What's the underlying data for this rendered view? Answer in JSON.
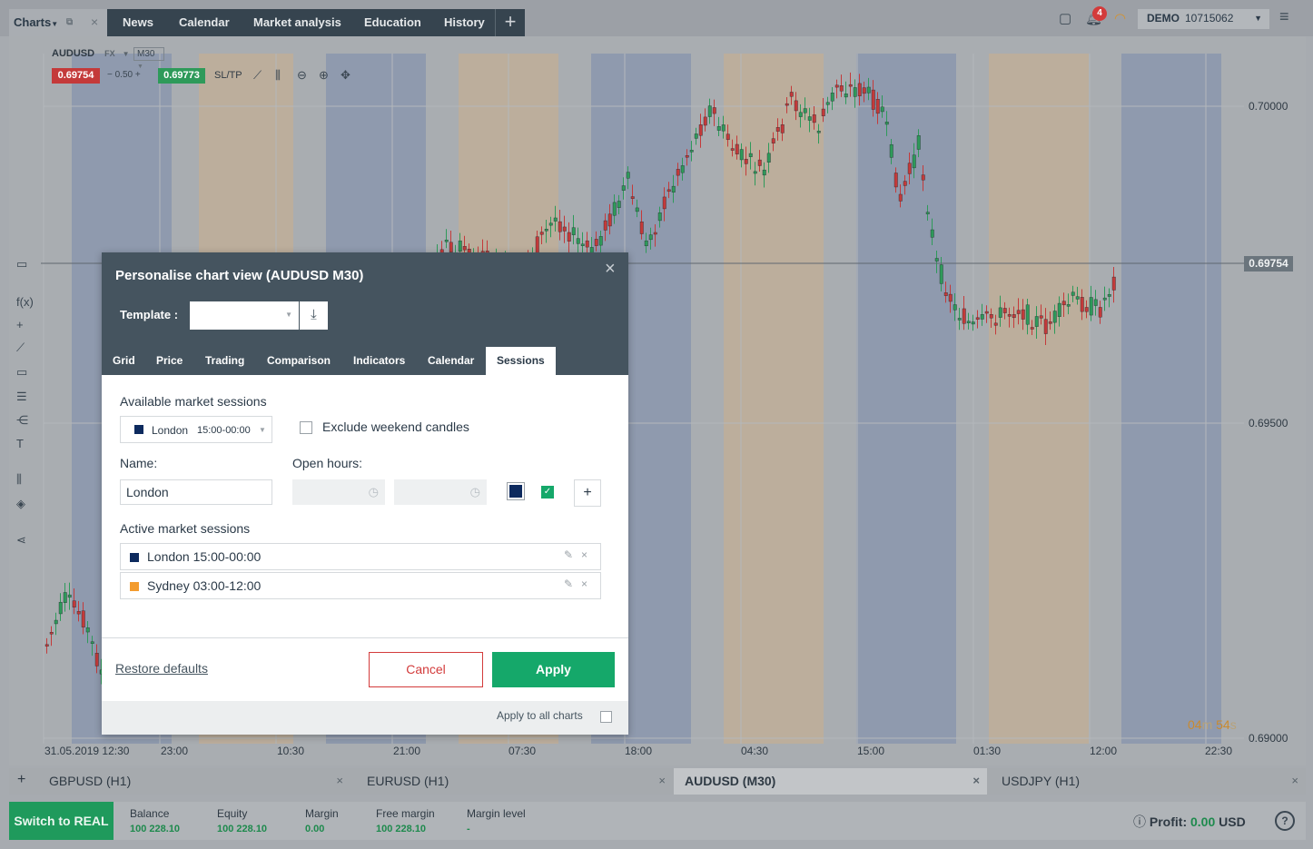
{
  "topbar": {
    "charts_label": "Charts",
    "nav": [
      "News",
      "Calendar",
      "Market analysis",
      "Education",
      "History"
    ],
    "plus": "+",
    "notifications_count": "4",
    "account_mode": "DEMO",
    "account_id": "10715062"
  },
  "chart": {
    "symbol": "AUDUSD",
    "market": "FX",
    "timeframe": "M30",
    "bid": "0.69754",
    "ask": "0.69773",
    "spread": "0.50",
    "sltp": "SL/TP",
    "current_price": "0.69754",
    "y_labels": [
      "0.70000",
      "0.69500",
      "0.69000"
    ],
    "x_labels": [
      "31.05.2019 12:30",
      "23:00",
      "10:30",
      "21:00",
      "07:30",
      "18:00",
      "04:30",
      "15:00",
      "01:30",
      "12:00",
      "22:30"
    ],
    "timer_min": "04",
    "timer_min_unit": "m",
    "timer_sec": "54",
    "timer_sec_unit": "s",
    "session_colors": {
      "london": "#8f9aae",
      "sydney": "#bcae9c"
    }
  },
  "dialog": {
    "title": "Personalise chart view (AUDUSD M30)",
    "template_label": "Template :",
    "tabs": [
      "Grid",
      "Price",
      "Trading",
      "Comparison",
      "Indicators",
      "Calendar",
      "Sessions"
    ],
    "active_tab": "Sessions",
    "available_label": "Available market sessions",
    "available_name": "London",
    "available_hours": "15:00-00:00",
    "exclude_weekend": "Exclude weekend candles",
    "name_label": "Name:",
    "name_value": "London",
    "open_hours_label": "Open hours:",
    "color": "#0d2a5e",
    "active_label": "Active market sessions",
    "active_sessions": [
      {
        "label": "London 15:00-00:00",
        "color": "#0d2a5e"
      },
      {
        "label": "Sydney 03:00-12:00",
        "color": "#f39c2f"
      }
    ],
    "restore": "Restore defaults",
    "cancel": "Cancel",
    "apply": "Apply",
    "apply_all": "Apply to all charts"
  },
  "bottom_tabs": [
    {
      "label": "GBPUSD (H1)"
    },
    {
      "label": "EURUSD (H1)"
    },
    {
      "label": "AUDUSD (M30)"
    },
    {
      "label": "USDJPY (H1)"
    }
  ],
  "account": {
    "switch_label": "Switch to REAL",
    "balance_label": "Balance",
    "balance": "100 228.10",
    "equity_label": "Equity",
    "equity": "100 228.10",
    "margin_label": "Margin",
    "margin": "0.00",
    "free_margin_label": "Free margin",
    "free_margin": "100 228.10",
    "margin_level_label": "Margin level",
    "margin_level": "-",
    "profit_label": "Profit:",
    "profit_value": "0.00",
    "profit_currency": "USD"
  }
}
